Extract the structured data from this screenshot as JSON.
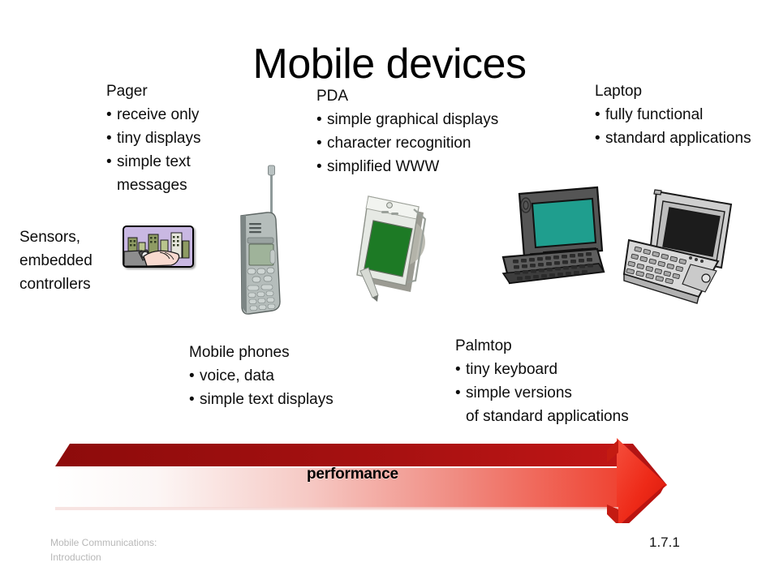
{
  "slide": {
    "title": "Mobile devices",
    "number": "1.7.1"
  },
  "blocks": {
    "pager": {
      "head": "Pager",
      "items": [
        "receive only",
        "tiny displays",
        "simple text",
        "messages"
      ]
    },
    "pda": {
      "head": "PDA",
      "items": [
        "simple graphical displays",
        "character recognition",
        "simplified WWW"
      ]
    },
    "laptop": {
      "head": "Laptop",
      "items": [
        "fully functional",
        "standard applications"
      ]
    },
    "phones": {
      "head": "Mobile phones",
      "items": [
        "voice, data",
        "simple text displays"
      ]
    },
    "palmtop": {
      "head": "Palmtop",
      "items": [
        "tiny keyboard",
        "simple versions",
        "of standard applications"
      ]
    },
    "sensors": {
      "line1": "Sensors,",
      "line2": "embedded",
      "line3": "controllers"
    }
  },
  "arrow": {
    "label": "performance",
    "color_bright": "#ee2222",
    "color_dark": "#9e0d0d",
    "color_light": "#fbfbfb"
  },
  "footer": {
    "line1": "Mobile Communications:",
    "line2": "Introduction"
  },
  "icons": {
    "sensors_clipart": "hands-city-watch-clipart",
    "phone": "mobile-phone-device",
    "pda": "pda-tablet-device",
    "laptop": "laptop-device",
    "palmtop": "palmtop-device"
  }
}
